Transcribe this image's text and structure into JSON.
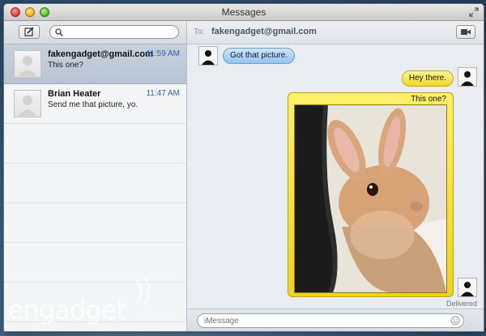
{
  "window": {
    "title": "Messages"
  },
  "sidebar": {
    "search_placeholder": "",
    "conversations": [
      {
        "name": "fakengadget@gmail.com",
        "time": "11:59 AM",
        "preview": "This one?",
        "selected": true
      },
      {
        "name": "Brian Heater",
        "time": "11:47 AM",
        "preview": "Send me that picture, yo.",
        "selected": false
      }
    ]
  },
  "chat": {
    "to_label": "To:",
    "recipient": "fakengadget@gmail.com",
    "messages": [
      {
        "from": "them",
        "text": "Got that picture."
      },
      {
        "from": "me",
        "text": "Hey there."
      },
      {
        "from": "me",
        "text": "This one?",
        "type": "photo"
      }
    ],
    "status": "Delivered",
    "input_placeholder": "iMessage"
  },
  "watermark": {
    "text": "engadget"
  },
  "colors": {
    "bubble_blue": "#93c4ef",
    "bubble_yellow": "#f0d92a",
    "selected_row": "#b8c4d3",
    "time_blue": "#3060b8"
  },
  "icons": [
    "close-icon",
    "minimize-icon",
    "zoom-icon",
    "fullscreen-icon",
    "compose-icon",
    "search-icon",
    "video-camera-icon",
    "emoji-icon"
  ]
}
